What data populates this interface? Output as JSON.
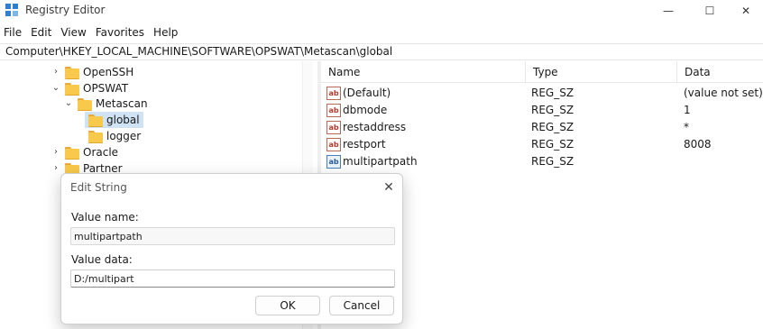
{
  "window": {
    "title": "Registry Editor",
    "minimize_glyph": "—",
    "maximize_glyph": "☐",
    "close_glyph": "✕"
  },
  "menu": [
    "File",
    "Edit",
    "View",
    "Favorites",
    "Help"
  ],
  "address_path": "Computer\\HKEY_LOCAL_MACHINE\\SOFTWARE\\OPSWAT\\Metascan\\global",
  "tree": {
    "items": [
      {
        "label": "OpenSSH",
        "expander": "collapsed"
      },
      {
        "label": "OPSWAT",
        "expander": "expanded"
      },
      {
        "label": "Metascan",
        "expander": "expanded"
      },
      {
        "label": "global",
        "expander": "none",
        "selected": true
      },
      {
        "label": "logger",
        "expander": "none"
      },
      {
        "label": "Oracle",
        "expander": "collapsed"
      },
      {
        "label": "Partner",
        "expander": "collapsed"
      }
    ]
  },
  "list": {
    "columns": [
      "Name",
      "Type",
      "Data"
    ],
    "rows": [
      {
        "name": "(Default)",
        "type": "REG_SZ",
        "data": "(value not set)",
        "icon": "string-value-icon"
      },
      {
        "name": "dbmode",
        "type": "REG_SZ",
        "data": "1",
        "icon": "string-value-icon"
      },
      {
        "name": "restaddress",
        "type": "REG_SZ",
        "data": "*",
        "icon": "string-value-icon"
      },
      {
        "name": "restport",
        "type": "REG_SZ",
        "data": "8008",
        "icon": "string-value-icon"
      },
      {
        "name": "multipartpath",
        "type": "REG_SZ",
        "data": "",
        "icon": "string-value-icon",
        "selected": true
      }
    ]
  },
  "dialog": {
    "title": "Edit String",
    "value_name_label": "Value name:",
    "value_name": "multipartpath",
    "value_data_label": "Value data:",
    "value_data": "D:/multipart",
    "ok_label": "OK",
    "cancel_label": "Cancel",
    "close_glyph": "✕"
  },
  "colors": {
    "selection": "#cfe3f5",
    "folder": "#f8c94a"
  }
}
